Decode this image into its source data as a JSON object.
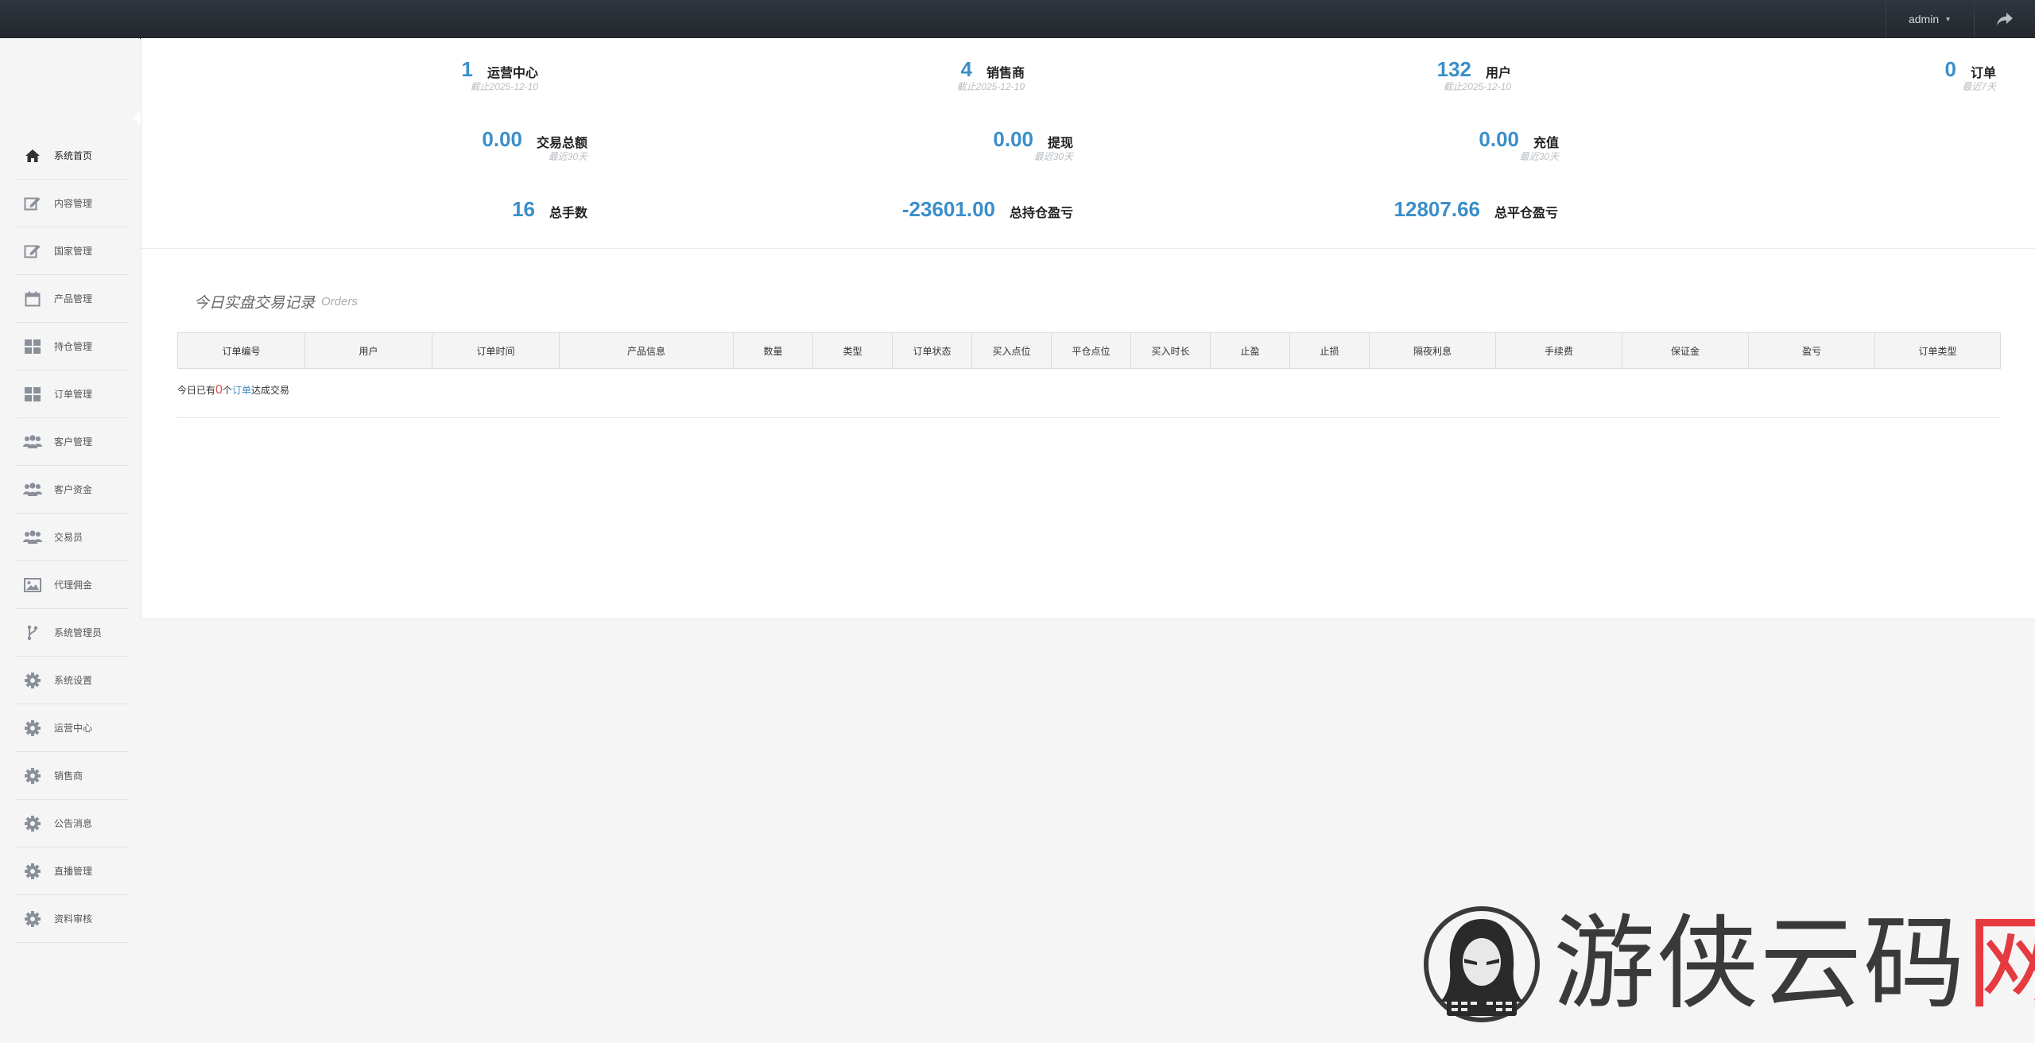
{
  "topbar": {
    "user": "admin",
    "logout_icon": "share-arrow-icon"
  },
  "sidebar": {
    "items": [
      {
        "label": "系统首页",
        "icon": "home-icon",
        "active": true
      },
      {
        "label": "内容管理",
        "icon": "edit-icon"
      },
      {
        "label": "国家管理",
        "icon": "edit-icon"
      },
      {
        "label": "产品管理",
        "icon": "calendar-icon"
      },
      {
        "label": "持仓管理",
        "icon": "grid-icon"
      },
      {
        "label": "订单管理",
        "icon": "grid-icon"
      },
      {
        "label": "客户管理",
        "icon": "users-icon"
      },
      {
        "label": "客户资金",
        "icon": "users-icon"
      },
      {
        "label": "交易员",
        "icon": "users-icon"
      },
      {
        "label": "代理佣金",
        "icon": "image-icon"
      },
      {
        "label": "系统管理员",
        "icon": "branch-icon"
      },
      {
        "label": "系统设置",
        "icon": "gear-icon"
      },
      {
        "label": "运营中心",
        "icon": "gear-icon"
      },
      {
        "label": "销售商",
        "icon": "gear-icon"
      },
      {
        "label": "公告消息",
        "icon": "gear-icon"
      },
      {
        "label": "直播管理",
        "icon": "gear-icon"
      },
      {
        "label": "资料审核",
        "icon": "gear-icon"
      }
    ]
  },
  "stats": {
    "operation_center": {
      "value": "1",
      "label": "运营中心",
      "sub": "截止2025-12-10"
    },
    "dealers": {
      "value": "4",
      "label": "销售商",
      "sub": "截止2025-12-10"
    },
    "users": {
      "value": "132",
      "label": "用户",
      "sub": "截止2025-12-10"
    },
    "orders": {
      "value": "0",
      "label": "订单",
      "sub": "最近7天"
    },
    "trade_total": {
      "value": "0.00",
      "label": "交易总额",
      "sub": "最近30天"
    },
    "withdraw": {
      "value": "0.00",
      "label": "提现",
      "sub": "最近30天"
    },
    "recharge": {
      "value": "0.00",
      "label": "充值",
      "sub": "最近30天"
    },
    "total_lots": {
      "value": "16",
      "label": "总手数"
    },
    "holding_pl": {
      "value": "-23601.00",
      "label": "总持仓盈亏"
    },
    "closed_pl": {
      "value": "12807.66",
      "label": "总平仓盈亏"
    }
  },
  "orders_section": {
    "title": "今日实盘交易记录",
    "subtitle": "Orders",
    "columns": [
      "订单编号",
      "用户",
      "订单时间",
      "产品信息",
      "数量",
      "类型",
      "订单状态",
      "买入点位",
      "平仓点位",
      "买入时长",
      "止盈",
      "止损",
      "隔夜利息",
      "手续费",
      "保证金",
      "盈亏",
      "订单类型"
    ],
    "empty_prefix": "今日已有",
    "empty_count": "0",
    "empty_mid": "个",
    "empty_link": "订单",
    "empty_suffix": "达成交易"
  },
  "watermark": {
    "text_dark": "游侠云码",
    "text_red": "网",
    "logo": "hacker-logo"
  }
}
